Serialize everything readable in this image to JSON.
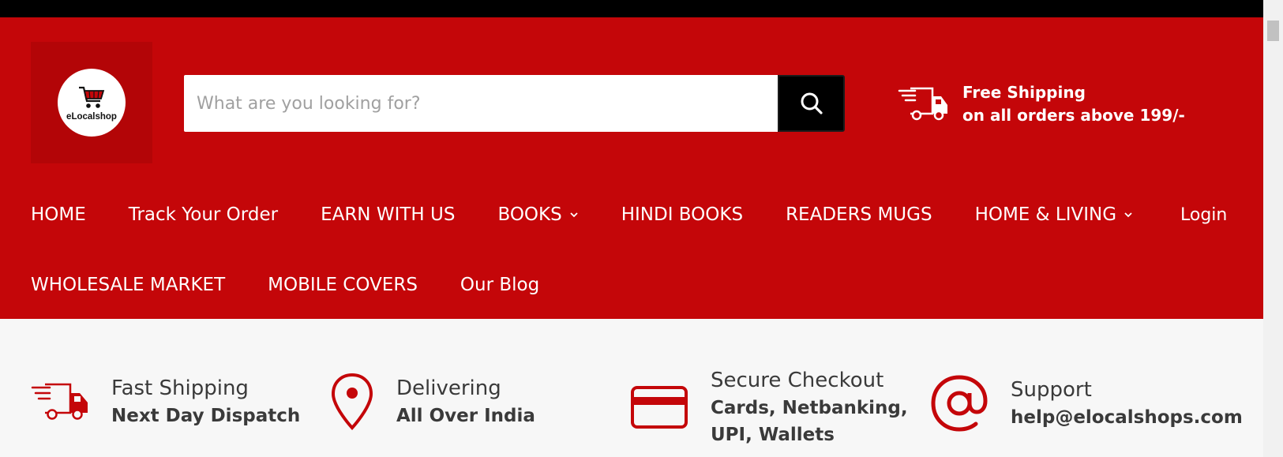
{
  "brand": {
    "logo_text": "eLocalshop"
  },
  "search": {
    "placeholder": "What are you looking for?"
  },
  "shipping_promo": {
    "line1": "Free Shipping",
    "line2": "on all orders above 199/-"
  },
  "nav": {
    "row1": [
      {
        "label": "HOME"
      },
      {
        "label": "Track Your Order"
      },
      {
        "label": "EARN WITH US"
      },
      {
        "label": "BOOKS"
      },
      {
        "label": "HINDI BOOKS"
      },
      {
        "label": "READERS MUGS"
      },
      {
        "label": "HOME & LIVING"
      }
    ],
    "row2": [
      {
        "label": "WHOLESALE MARKET"
      },
      {
        "label": "MOBILE COVERS"
      },
      {
        "label": "Our Blog"
      }
    ],
    "login": "Login"
  },
  "features": [
    {
      "title": "Fast Shipping",
      "subtitle": "Next Day Dispatch",
      "icon": "delivery-truck-icon"
    },
    {
      "title": "Delivering",
      "subtitle": "All Over India",
      "icon": "location-pin-icon"
    },
    {
      "title": "Secure Checkout",
      "subtitle": "Cards, Netbanking,",
      "subtitle2": "UPI, Wallets",
      "icon": "credit-card-icon"
    },
    {
      "title": "Support",
      "subtitle": "help@elocalshops.com",
      "icon": "at-sign-icon"
    }
  ],
  "colors": {
    "brand_red": "#c40609",
    "black": "#000000",
    "white": "#ffffff",
    "text_dark": "#3a3a3a"
  }
}
